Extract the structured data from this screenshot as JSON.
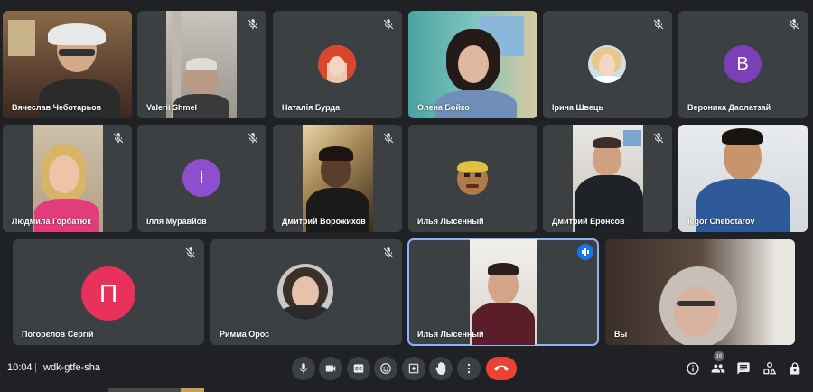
{
  "participants": [
    {
      "name": "Вячеслав Чеботарьов",
      "muted": false
    },
    {
      "name": "Valerii Shmel",
      "muted": true
    },
    {
      "name": "Наталія Бурда",
      "muted": true
    },
    {
      "name": "Олена Бойко",
      "muted": false
    },
    {
      "name": "Ірина Швець",
      "muted": true
    },
    {
      "name": "Вероника Даолатзай",
      "muted": true,
      "avatar_letter": "В",
      "avatar_color": "#7b3fb8"
    },
    {
      "name": "Людмила Горбатюк",
      "muted": true
    },
    {
      "name": "Ілля Муравйов",
      "muted": true,
      "avatar_letter": "І",
      "avatar_color": "#8e4fcf"
    },
    {
      "name": "Дмитрий Ворожихов",
      "muted": true
    },
    {
      "name": "Илья Лысенный",
      "muted": false
    },
    {
      "name": "Дмитрий Еронсов",
      "muted": true
    },
    {
      "name": "Iegor Chebotarov",
      "muted": true
    },
    {
      "name": "Погорєлов Сергій",
      "muted": true,
      "avatar_letter": "П",
      "avatar_color": "#e8315b"
    },
    {
      "name": "Римма Орос",
      "muted": true
    },
    {
      "name": "Илья Лысенный",
      "muted": false,
      "speaking": true
    },
    {
      "name": "Вы",
      "muted": false
    }
  ],
  "bottombar": {
    "time": "10:04",
    "separator": "|",
    "meeting_code": "wdk-gtfe-sha",
    "participant_count": "16"
  },
  "colors": {
    "background": "#202124",
    "tile": "#3c4043",
    "accent": "#8ab4f8",
    "end_call": "#ea4335"
  },
  "icons": [
    "mic-icon",
    "camera-icon",
    "captions-icon",
    "emoji-icon",
    "present-icon",
    "raise-hand-icon",
    "more-options-icon",
    "end-call-icon",
    "info-icon",
    "people-icon",
    "chat-icon",
    "activities-icon",
    "host-controls-icon"
  ]
}
